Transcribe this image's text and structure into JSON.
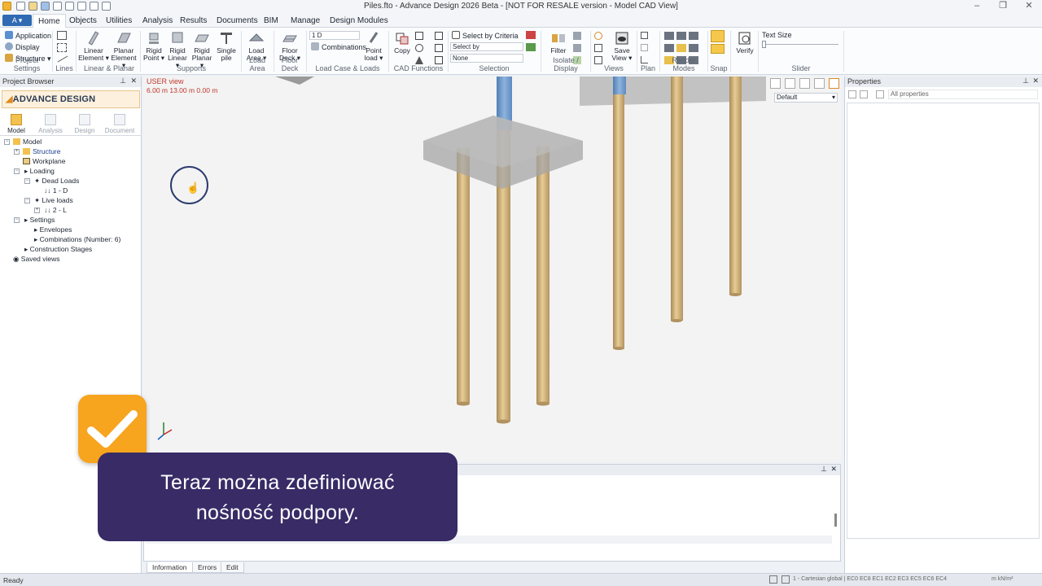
{
  "window": {
    "title": "Piles.fto - Advance Design 2026 Beta - [NOT FOR RESALE version - Model CAD View]"
  },
  "ribbon_tabs": [
    "Home",
    "Objects",
    "Utilities",
    "Analysis",
    "Results",
    "Documents",
    "BIM",
    "Manage",
    "Design Modules"
  ],
  "ribbon": {
    "project_settings": {
      "application": "Application",
      "display": "Display",
      "structure": "Structure",
      "group": "Project Settings"
    },
    "lines_group": "Lines",
    "linear_planar": {
      "linear": "Linear Element",
      "planar": "Planar Element",
      "group": "Linear & Planar"
    },
    "supports": {
      "rigid_point": "Rigid Point",
      "rigid_linear": "Rigid Linear",
      "rigid_planar": "Rigid Planar",
      "single_pile": "Single pile",
      "group": "Supports"
    },
    "load_area": {
      "label": "Load Area",
      "group": "Load Area"
    },
    "floor_deck": {
      "label": "Floor Deck",
      "group": "Floor Deck"
    },
    "loads": {
      "case_value": "1 D",
      "combinations": "Combinations",
      "point_load": "Point load",
      "group": "Load Case & Loads"
    },
    "cad": {
      "copy": "Copy",
      "group": "CAD Functions"
    },
    "selection": {
      "criteria": "Select by Criteria",
      "select_by": "Select by",
      "none": "None",
      "group": "Selection"
    },
    "isolate": {
      "filter": "Filter",
      "group": "Isolate / Display"
    },
    "views": {
      "save_view": "Save View",
      "group": "Views"
    },
    "plan_group": "Plan",
    "render_group": "Render Modes",
    "snap_group": "Snap",
    "verify": "Verify",
    "slider": {
      "text_size": "Text Size",
      "group": "Slider"
    }
  },
  "project_browser": {
    "title": "Project Browser",
    "logo": "ADVANCE DESIGN",
    "tabs": [
      "Model",
      "Analysis",
      "Design",
      "Document"
    ],
    "tree": {
      "model": "Model",
      "structure": "Structure",
      "workplane": "Workplane",
      "loading": "Loading",
      "dead_loads": "Dead Loads",
      "case_1": "1 - D",
      "live_loads": "Live loads",
      "case_2": "2 - L",
      "settings": "Settings",
      "envelopes": "Envelopes",
      "combinations": "Combinations (Number: 6)",
      "construction_stages": "Construction Stages",
      "saved_views": "Saved views"
    }
  },
  "view": {
    "name": "USER view",
    "coords": "6.00 m  13.00 m  0.00 m",
    "display_preset": "Default"
  },
  "properties": {
    "title": "Properties",
    "filter": "All properties"
  },
  "command_tabs": [
    "Information",
    "Errors",
    "Edit"
  ],
  "status": {
    "left": "Ready",
    "right": "1 - Cartesian global | EC0 EC8 EC1 EC2 EC3 EC5 EC6 EC4",
    "units": "m  kN/m²"
  },
  "caption": {
    "line1": "Teraz można zdefiniować",
    "line2": "nośność podpory."
  }
}
